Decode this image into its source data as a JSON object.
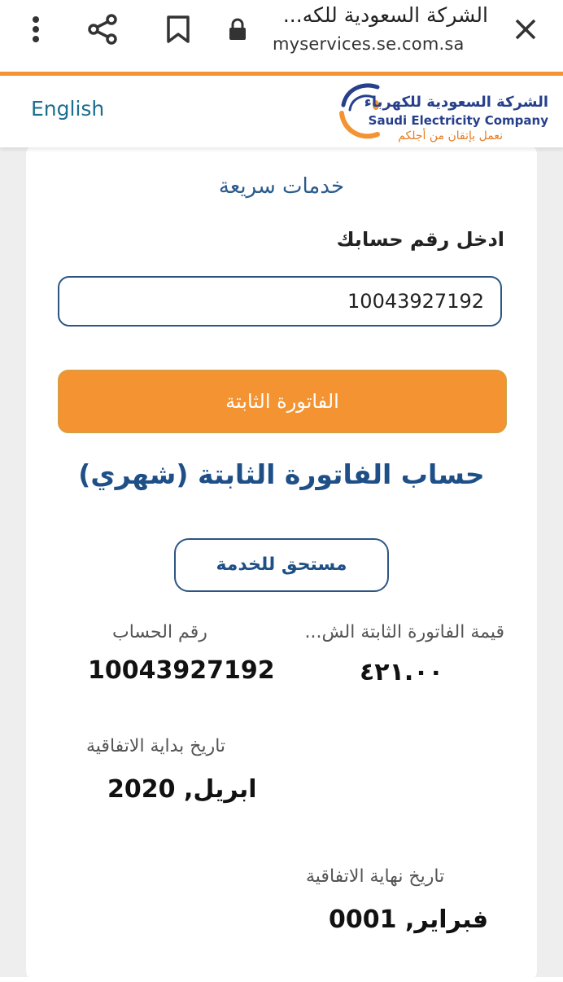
{
  "browser": {
    "page_title": "الشركة السعودية للكه...",
    "url": "myservices.se.com.sa",
    "icons": [
      "more-vert-icon",
      "share-icon",
      "bookmark-icon",
      "lock-icon",
      "close-icon"
    ]
  },
  "header": {
    "language_link": "English",
    "logo": {
      "arabic_name": "الشركة السعودية للكهرباء",
      "english_name": "Saudi Electricity Company",
      "tagline": "نعمل بإتقان من أجلكم"
    }
  },
  "quick_services": {
    "title": "خدمات سريعة",
    "account_label": "ادخل رقم حسابك",
    "account_value": "10043927192",
    "fixed_bill_button": "الفاتورة الثابتة"
  },
  "result": {
    "title": "حساب الفاتورة الثابتة (شهري)",
    "status": "مستحق للخدمة",
    "fields": {
      "fixed_bill_value_label": "قيمة الفاتورة الثابتة الش...",
      "fixed_bill_value": "٤٢١.٠٠",
      "account_number_label": "رقم الحساب",
      "account_number": "10043927192",
      "agreement_start_label": "تاريخ بداية الاتفاقية",
      "agreement_start": "ابريل, 2020",
      "agreement_end_label": "تاريخ نهاية الاتفاقية",
      "agreement_end": "فبراير, 0001"
    }
  },
  "colors": {
    "accent_orange": "#f39332",
    "brand_blue": "#1e4f87",
    "link_teal": "#1b6e8f"
  }
}
